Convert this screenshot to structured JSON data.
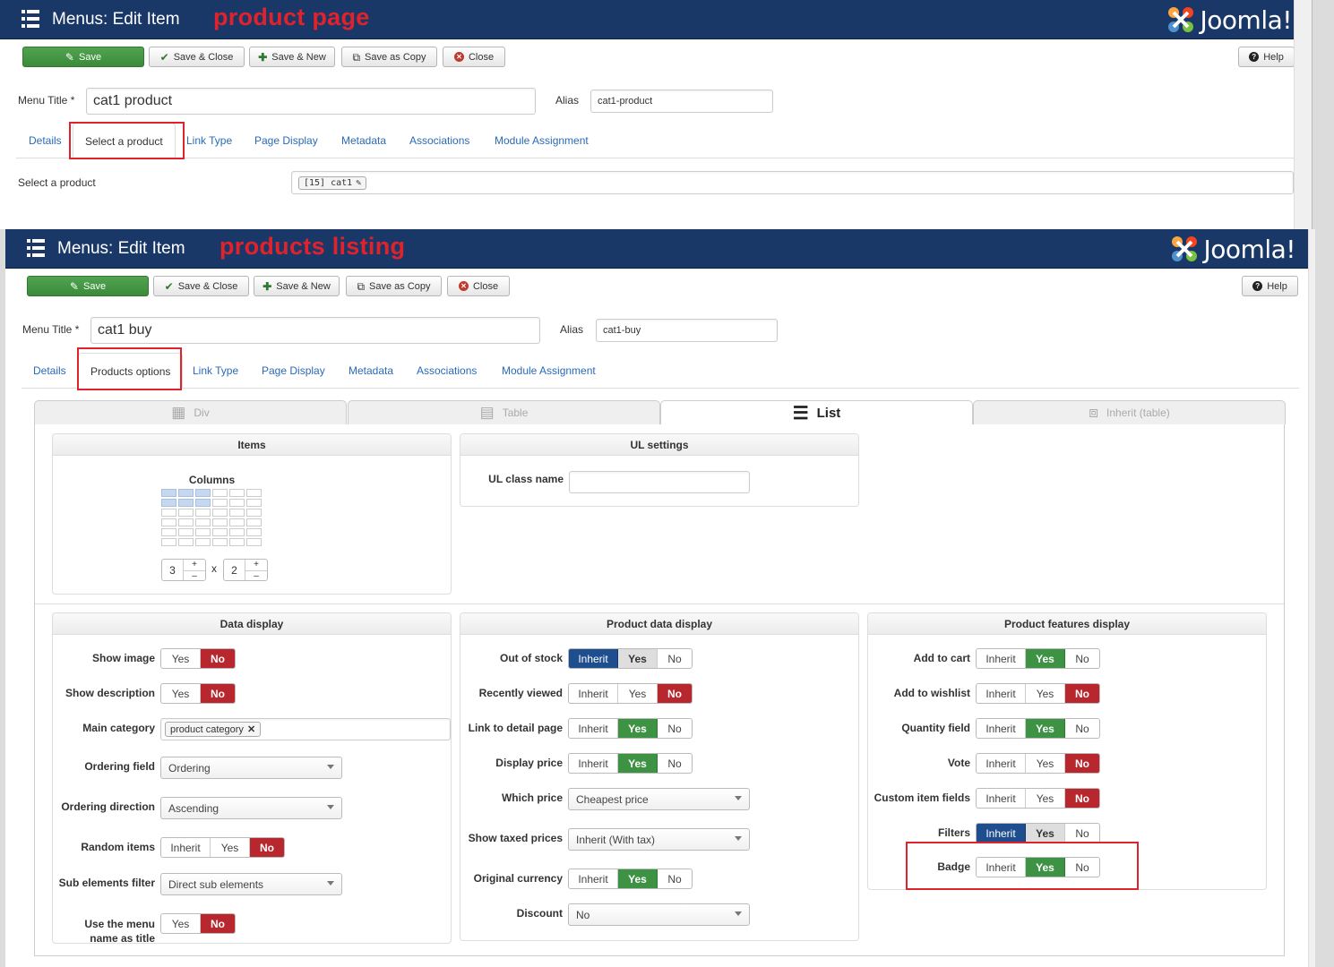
{
  "panel1": {
    "header": {
      "title": "Menus: Edit Item",
      "annotation": "product page",
      "brand": "Joomla!"
    },
    "toolbar": {
      "save": "Save",
      "save_close": "Save & Close",
      "save_new": "Save & New",
      "save_copy": "Save as Copy",
      "close": "Close",
      "help": "Help"
    },
    "menu_title_label": "Menu Title *",
    "menu_title_value": "cat1 product",
    "alias_label": "Alias",
    "alias_value": "cat1-product",
    "tabs": [
      "Details",
      "Select a product",
      "Link Type",
      "Page Display",
      "Metadata",
      "Associations",
      "Module Assignment"
    ],
    "select_product_label": "Select a product",
    "selected_product": "[15] cat1"
  },
  "panel2": {
    "header": {
      "title": "Menus: Edit Item",
      "annotation": "products listing",
      "brand": "Joomla!"
    },
    "toolbar": {
      "save": "Save",
      "save_close": "Save & Close",
      "save_new": "Save & New",
      "save_copy": "Save as Copy",
      "close": "Close",
      "help": "Help"
    },
    "menu_title_label": "Menu Title *",
    "menu_title_value": "cat1 buy",
    "alias_label": "Alias",
    "alias_value": "cat1-buy",
    "tabs": [
      "Details",
      "Products options",
      "Link Type",
      "Page Display",
      "Metadata",
      "Associations",
      "Module Assignment"
    ],
    "layout_tabs": [
      "Div",
      "Table",
      "List",
      "Inherit (table)"
    ],
    "items": {
      "title": "Items",
      "columns_label": "Columns",
      "columns": "3",
      "rows": "2",
      "times": "x",
      "plus": "+",
      "minus": "–"
    },
    "ul_settings": {
      "title": "UL settings",
      "class_label": "UL class name",
      "class_value": ""
    },
    "data_display": {
      "title": "Data display",
      "show_image": {
        "label": "Show image",
        "options": [
          "Yes",
          "No"
        ],
        "selected": "No"
      },
      "show_description": {
        "label": "Show description",
        "options": [
          "Yes",
          "No"
        ],
        "selected": "No"
      },
      "main_category": {
        "label": "Main category",
        "tag": "product category"
      },
      "ordering_field": {
        "label": "Ordering field",
        "value": "Ordering"
      },
      "ordering_direction": {
        "label": "Ordering direction",
        "value": "Ascending"
      },
      "random_items": {
        "label": "Random items",
        "options": [
          "Inherit",
          "Yes",
          "No"
        ],
        "selected": "No"
      },
      "sub_elements_filter": {
        "label": "Sub elements filter",
        "value": "Direct sub elements"
      },
      "use_menu_name": {
        "label_line1": "Use the menu",
        "label_line2": "name as title",
        "options": [
          "Yes",
          "No"
        ],
        "selected": "No"
      }
    },
    "product_data_display": {
      "title": "Product data display",
      "out_of_stock": {
        "label": "Out of stock",
        "options": [
          "Inherit",
          "Yes",
          "No"
        ],
        "selected": "Inherit"
      },
      "recently_viewed": {
        "label": "Recently viewed",
        "options": [
          "Inherit",
          "Yes",
          "No"
        ],
        "selected": "No"
      },
      "link_to_detail": {
        "label": "Link to detail page",
        "options": [
          "Inherit",
          "Yes",
          "No"
        ],
        "selected": "Yes"
      },
      "display_price": {
        "label": "Display price",
        "options": [
          "Inherit",
          "Yes",
          "No"
        ],
        "selected": "Yes"
      },
      "which_price": {
        "label": "Which price",
        "value": "Cheapest price"
      },
      "show_taxed": {
        "label": "Show taxed prices",
        "value": "Inherit (With tax)"
      },
      "original_currency": {
        "label": "Original currency",
        "options": [
          "Inherit",
          "Yes",
          "No"
        ],
        "selected": "Yes"
      },
      "discount": {
        "label": "Discount",
        "value": "No"
      }
    },
    "product_features_display": {
      "title": "Product features display",
      "add_to_cart": {
        "label": "Add to cart",
        "options": [
          "Inherit",
          "Yes",
          "No"
        ],
        "selected": "Yes"
      },
      "add_to_wishlist": {
        "label": "Add to wishlist",
        "options": [
          "Inherit",
          "Yes",
          "No"
        ],
        "selected": "No"
      },
      "quantity_field": {
        "label": "Quantity field",
        "options": [
          "Inherit",
          "Yes",
          "No"
        ],
        "selected": "Yes"
      },
      "vote": {
        "label": "Vote",
        "options": [
          "Inherit",
          "Yes",
          "No"
        ],
        "selected": "No"
      },
      "custom_item_fields": {
        "label": "Custom item fields",
        "options": [
          "Inherit",
          "Yes",
          "No"
        ],
        "selected": "No"
      },
      "filters": {
        "label": "Filters",
        "options": [
          "Inherit",
          "Yes",
          "No"
        ],
        "selected": "Inherit"
      },
      "badge": {
        "label": "Badge",
        "options": [
          "Inherit",
          "Yes",
          "No"
        ],
        "selected": "Yes"
      }
    }
  },
  "colors": {
    "header_bg": "#1a3867",
    "annotation_red": "#e0222c",
    "yes_green": "#3d9243",
    "no_red": "#b7272d",
    "inherit_blue": "#1f4e8f",
    "link_blue": "#2a6ab7"
  }
}
